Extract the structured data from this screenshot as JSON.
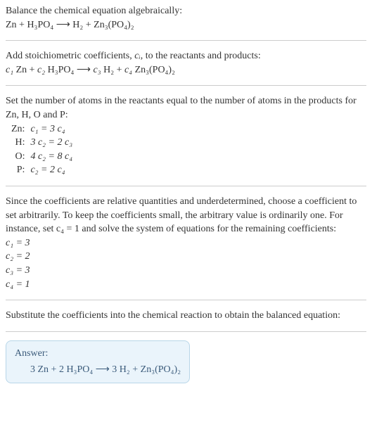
{
  "problem": {
    "prompt": "Balance the chemical equation algebraically:",
    "equation": "Zn + H₃PO₄  ⟶  H₂ + Zn₃(PO₄)₂"
  },
  "step1": {
    "text_before": "Add stoichiometric coefficients, ",
    "ci": "cᵢ",
    "text_after": ", to the reactants and products:",
    "equation_parts": {
      "c1": "c₁",
      "zn": " Zn + ",
      "c2": "c₂",
      "h3po4": " H₃PO₄  ⟶  ",
      "c3": "c₃",
      "h2": " H₂ + ",
      "c4": "c₄",
      "zn3po4": " Zn₃(PO₄)₂"
    }
  },
  "step2": {
    "text": "Set the number of atoms in the reactants equal to the number of atoms in the products for Zn, H, O and P:",
    "rows": [
      {
        "elem": "Zn:",
        "eq": "c₁ = 3 c₄"
      },
      {
        "elem": "H:",
        "eq": "3 c₂ = 2 c₃"
      },
      {
        "elem": "O:",
        "eq": "4 c₂ = 8 c₄"
      },
      {
        "elem": "P:",
        "eq": "c₂ = 2 c₄"
      }
    ]
  },
  "step3": {
    "text": "Since the coefficients are relative quantities and underdetermined, choose a coefficient to set arbitrarily. To keep the coefficients small, the arbitrary value is ordinarily one. For instance, set c₄ = 1 and solve the system of equations for the remaining coefficients:",
    "solutions": [
      "c₁ = 3",
      "c₂ = 2",
      "c₃ = 3",
      "c₄ = 1"
    ]
  },
  "step4": {
    "text": "Substitute the coefficients into the chemical reaction to obtain the balanced equation:"
  },
  "answer": {
    "label": "Answer:",
    "equation": "3 Zn + 2 H₃PO₄  ⟶  3 H₂ + Zn₃(PO₄)₂"
  }
}
